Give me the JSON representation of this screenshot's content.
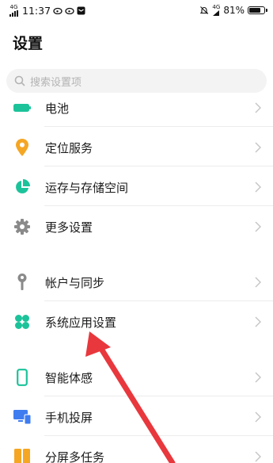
{
  "status_bar": {
    "network_type": "4G",
    "time": "11:37",
    "right_network": "4G",
    "battery_percent": "81%",
    "battery_level": 0.81
  },
  "header": {
    "title": "设置"
  },
  "search": {
    "placeholder": "搜索设置项"
  },
  "settings": {
    "items": [
      {
        "label": "电池",
        "icon": "battery-icon",
        "color": "#1cc39a"
      },
      {
        "label": "定位服务",
        "icon": "location-pin-icon",
        "color": "#f5a623"
      },
      {
        "label": "运存与存储空间",
        "icon": "storage-pie-icon",
        "color": "#1cc39a"
      },
      {
        "label": "更多设置",
        "icon": "gear-icon",
        "color": "#8a8a8a"
      },
      {
        "label": "帐户与同步",
        "icon": "key-icon",
        "color": "#8a8a8a"
      },
      {
        "label": "系统应用设置",
        "icon": "clover-apps-icon",
        "color": "#1cc39a"
      },
      {
        "label": "智能体感",
        "icon": "phone-outline-icon",
        "color": "#1cc39a"
      },
      {
        "label": "手机投屏",
        "icon": "screen-cast-icon",
        "color": "#3f7cf0"
      },
      {
        "label": "分屏多任务",
        "icon": "split-screen-icon",
        "color": "#f5a623"
      }
    ]
  },
  "annotation": {
    "arrow_color": "#e8383d"
  }
}
